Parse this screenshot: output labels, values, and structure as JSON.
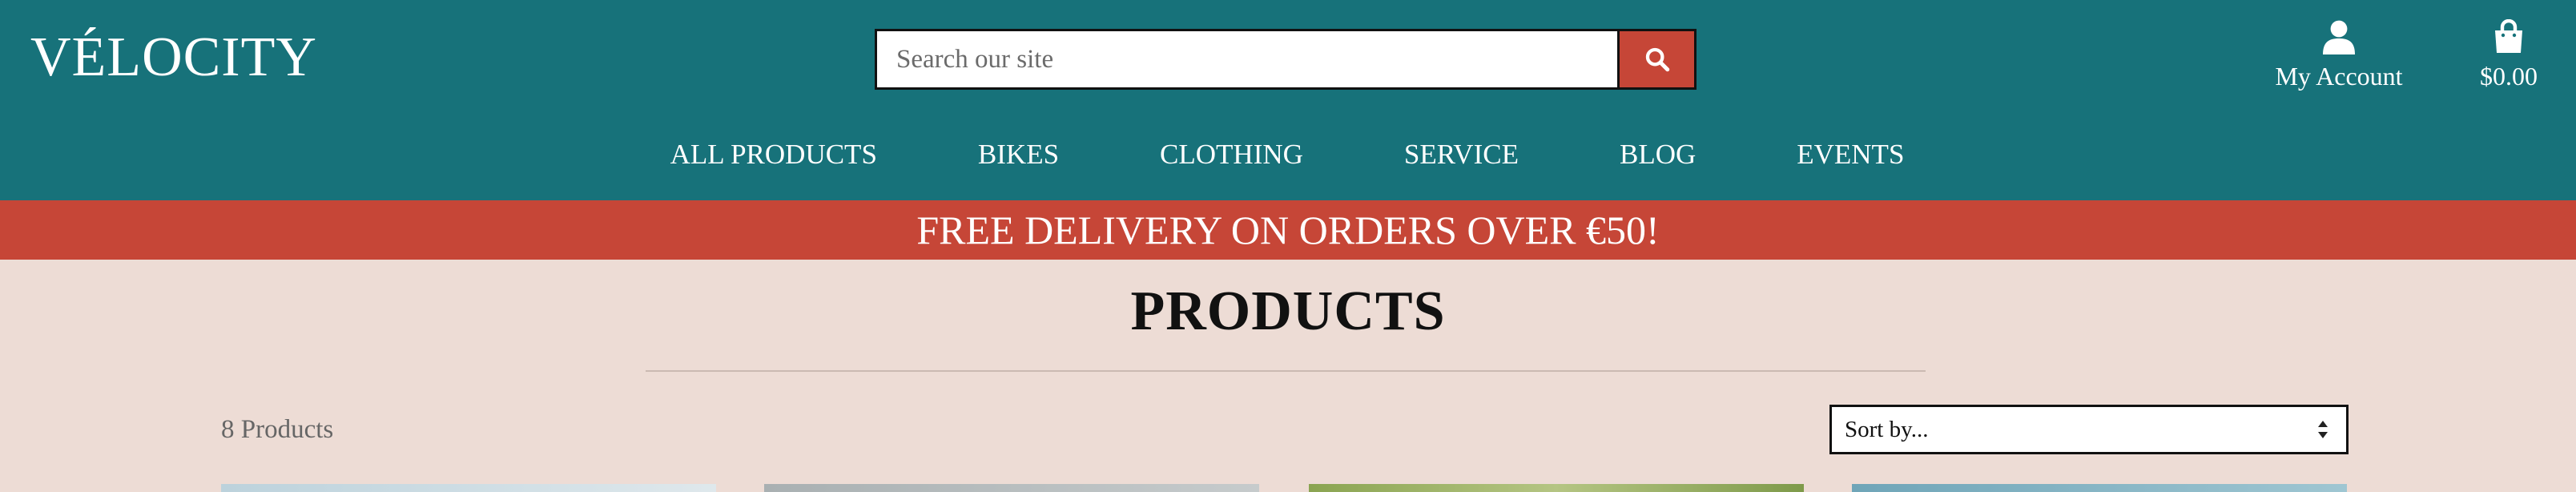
{
  "header": {
    "logo": "VÉLOCITY",
    "search_placeholder": "Search our site",
    "account_label": "My Account",
    "cart_total": "$0.00"
  },
  "nav": {
    "items": [
      "ALL PRODUCTS",
      "BIKES",
      "CLOTHING",
      "SERVICE",
      "BLOG",
      "EVENTS"
    ]
  },
  "banner": {
    "text": "FREE DELIVERY ON ORDERS OVER €50!"
  },
  "main": {
    "title": "PRODUCTS",
    "product_count": "8 Products",
    "sort_selected": "Sort by..."
  },
  "icons": {
    "search": "search-icon",
    "account": "user-icon",
    "cart": "shopping-bag-icon",
    "sort": "sort-arrows-icon"
  },
  "colors": {
    "header_bg": "#17727a",
    "accent_red": "#c64637",
    "page_bg": "#eddcd5"
  }
}
